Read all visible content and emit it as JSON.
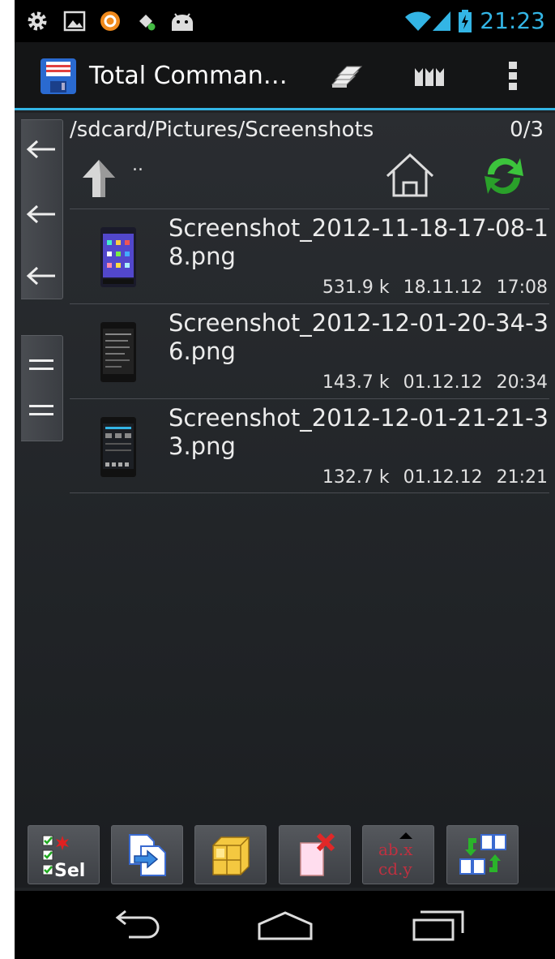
{
  "status_bar": {
    "time": "21:23",
    "left_icons": [
      "settings-icon",
      "gallery-icon",
      "app-icon",
      "usb-debug-icon",
      "android-icon"
    ],
    "right_icons": [
      "wifi-icon",
      "signal-icon",
      "battery-charging-icon"
    ],
    "accent_color": "#33b5e5"
  },
  "action_bar": {
    "app_icon": "floppy-disk-icon",
    "title": "Total Comman…",
    "buttons": [
      "copy-panels-icon",
      "bookmarks-icon",
      "overflow-menu-icon"
    ]
  },
  "side_tabs": {
    "back_buttons": [
      "back-arrow-icon",
      "back-arrow-icon",
      "back-arrow-icon"
    ],
    "menu_buttons": [
      "equal-lines-icon",
      "equal-lines-icon"
    ]
  },
  "panel": {
    "path": "/sdcard/Pictures/Screenshots",
    "selection_count": "0/3",
    "parent_dir_label": ".."
  },
  "files": [
    {
      "name": "Screenshot_2012-11-18-17-08-18.png",
      "size": "531.9 k",
      "date": "18.11.12",
      "time": "17:08"
    },
    {
      "name": "Screenshot_2012-12-01-20-34-36.png",
      "size": "143.7 k",
      "date": "01.12.12",
      "time": "20:34"
    },
    {
      "name": "Screenshot_2012-12-01-21-21-33.png",
      "size": "132.7 k",
      "date": "01.12.12",
      "time": "21:21"
    }
  ],
  "toolbar": {
    "buttons": [
      {
        "icon": "select-icon",
        "label": "Sel"
      },
      {
        "icon": "copy-move-icon"
      },
      {
        "icon": "pack-zip-icon"
      },
      {
        "icon": "delete-icon"
      },
      {
        "icon": "sort-icon",
        "label_top": "ab.x",
        "label_bottom": "cd.y"
      },
      {
        "icon": "swap-panels-icon"
      }
    ]
  },
  "nav_bar": [
    "back-nav-icon",
    "home-nav-icon",
    "recent-apps-icon"
  ]
}
